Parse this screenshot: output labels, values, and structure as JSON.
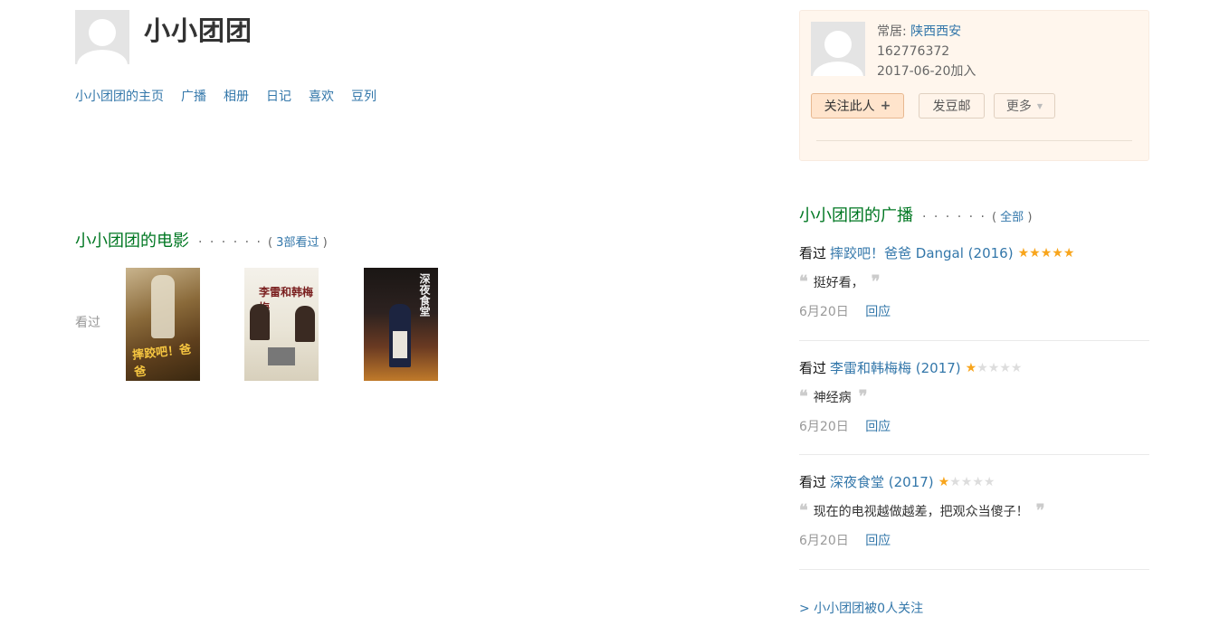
{
  "user": {
    "name": "小小团团"
  },
  "nav": [
    {
      "label": "小小团团的主页"
    },
    {
      "label": "广播"
    },
    {
      "label": "相册"
    },
    {
      "label": "日记"
    },
    {
      "label": "喜欢"
    },
    {
      "label": "豆列"
    }
  ],
  "movies": {
    "title": "小小团团的电影",
    "dots": "· · · · · ·",
    "count_prefix": "( ",
    "count_link": "3部看过",
    "count_suffix": " )",
    "seen_label": "看过",
    "posters": [
      {
        "text": "摔跤吧！爸爸"
      },
      {
        "text": "李雷和韩梅梅"
      },
      {
        "text": "深夜食堂"
      }
    ]
  },
  "profile": {
    "location_label": "常居: ",
    "location": "陕西西安",
    "user_id": "162776372",
    "joined": "2017-06-20加入",
    "follow_label": "关注此人",
    "follow_icon": "+",
    "mail_label": "发豆邮",
    "more_label": "更多",
    "more_icon": "▼"
  },
  "broadcast": {
    "title": "小小团团的广播",
    "dots": "· · · · · ·",
    "all_prefix": "( ",
    "all_link": "全部",
    "all_suffix": " )",
    "items": [
      {
        "action": "看过",
        "movie": "摔跤吧！爸爸 Dangal (2016)",
        "rating": 5,
        "comment": "挺好看，",
        "date": "6月20日",
        "reply": "回应"
      },
      {
        "action": "看过",
        "movie": "李雷和韩梅梅 (2017)",
        "rating": 1,
        "comment": "神经病",
        "date": "6月20日",
        "reply": "回应"
      },
      {
        "action": "看过",
        "movie": "深夜食堂 (2017)",
        "rating": 1,
        "comment": "现在的电视越做越差，把观众当傻子！",
        "date": "6月20日",
        "reply": "回应"
      }
    ]
  },
  "followers_link": "> 小小团团被0人关注",
  "colors": {
    "link": "#3377aa",
    "section_title": "#007722",
    "star_on": "#f8a51c",
    "card_bg": "#fff6ed"
  }
}
